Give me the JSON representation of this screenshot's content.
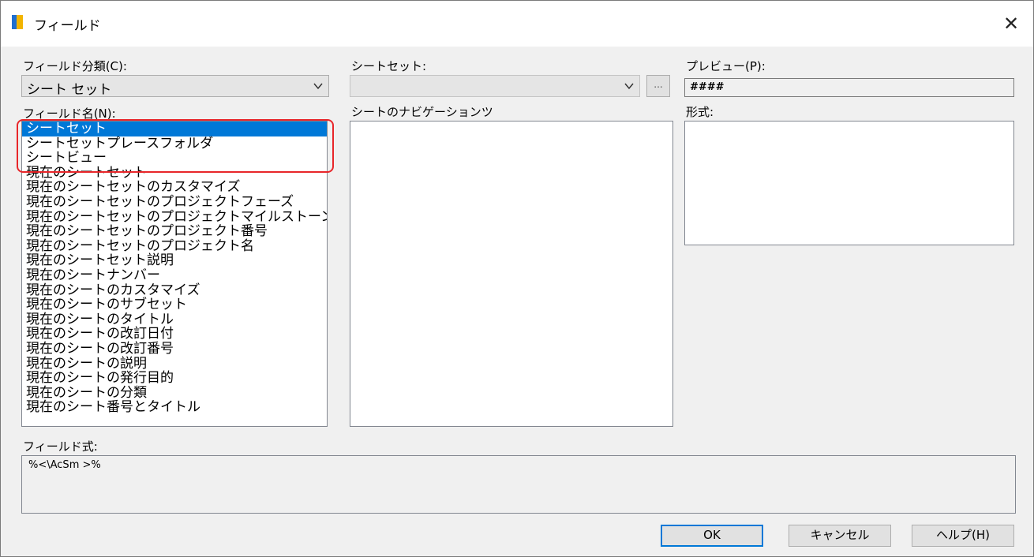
{
  "window": {
    "title": "フィールド"
  },
  "category": {
    "label": "フィールド分類(C):",
    "value": "シート セット"
  },
  "field_names": {
    "label": "フィールド名(N):",
    "items": [
      "シートセット",
      "シートセットプレースフォルダ",
      "シートビュー",
      "現在のシートセット",
      "現在のシートセットのカスタマイズ",
      "現在のシートセットのプロジェクトフェーズ",
      "現在のシートセットのプロジェクトマイルストーン",
      "現在のシートセットのプロジェクト番号",
      "現在のシートセットのプロジェクト名",
      "現在のシートセット説明",
      "現在のシートナンバー",
      "現在のシートのカスタマイズ",
      "現在のシートのサブセット",
      "現在のシートのタイトル",
      "現在のシートの改訂日付",
      "現在のシートの改訂番号",
      "現在のシートの説明",
      "現在のシートの発行目的",
      "現在のシートの分類",
      "現在のシート番号とタイトル"
    ],
    "selected_index": 0
  },
  "sheet_set": {
    "label": "シートセット:",
    "value": "",
    "browse_label": "..."
  },
  "navigation": {
    "label": "シートのナビゲーションツ"
  },
  "preview": {
    "label": "プレビュー(P):",
    "value": "####"
  },
  "format": {
    "label": "形式:"
  },
  "expression": {
    "label": "フィールド式:",
    "value": "%<\\AcSm >%"
  },
  "buttons": {
    "ok": "OK",
    "cancel": "キャンセル",
    "help": "ヘルプ(H)"
  },
  "colors": {
    "selection": "#0078d7",
    "highlight": "#e8262a"
  }
}
